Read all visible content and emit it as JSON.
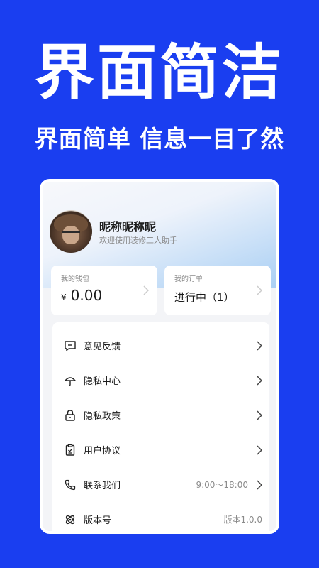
{
  "hero": {
    "title": "界面简洁",
    "subtitle": "界面简单 信息一目了然"
  },
  "profile": {
    "nickname": "昵称昵称昵",
    "welcome": "欢迎使用装修工人助手"
  },
  "wallet": {
    "label": "我的钱包",
    "currency": "¥",
    "amount": "0.00"
  },
  "orders": {
    "label": "我的订单",
    "status": "进行中（1）"
  },
  "menu": {
    "items": [
      {
        "label": "意见反馈",
        "icon": "feedback-icon"
      },
      {
        "label": "隐私中心",
        "icon": "umbrella-icon"
      },
      {
        "label": "隐私政策",
        "icon": "lock-icon"
      },
      {
        "label": "用户协议",
        "icon": "clipboard-icon"
      },
      {
        "label": "联系我们",
        "icon": "phone-icon",
        "extra": "9:00～18:00"
      },
      {
        "label": "版本号",
        "icon": "version-icon",
        "extra": "版本1.0.0"
      }
    ]
  },
  "colors": {
    "background": "#1a3ef0",
    "card": "#ffffff",
    "text": "#1b1b1b",
    "muted": "#8a8a8a"
  }
}
